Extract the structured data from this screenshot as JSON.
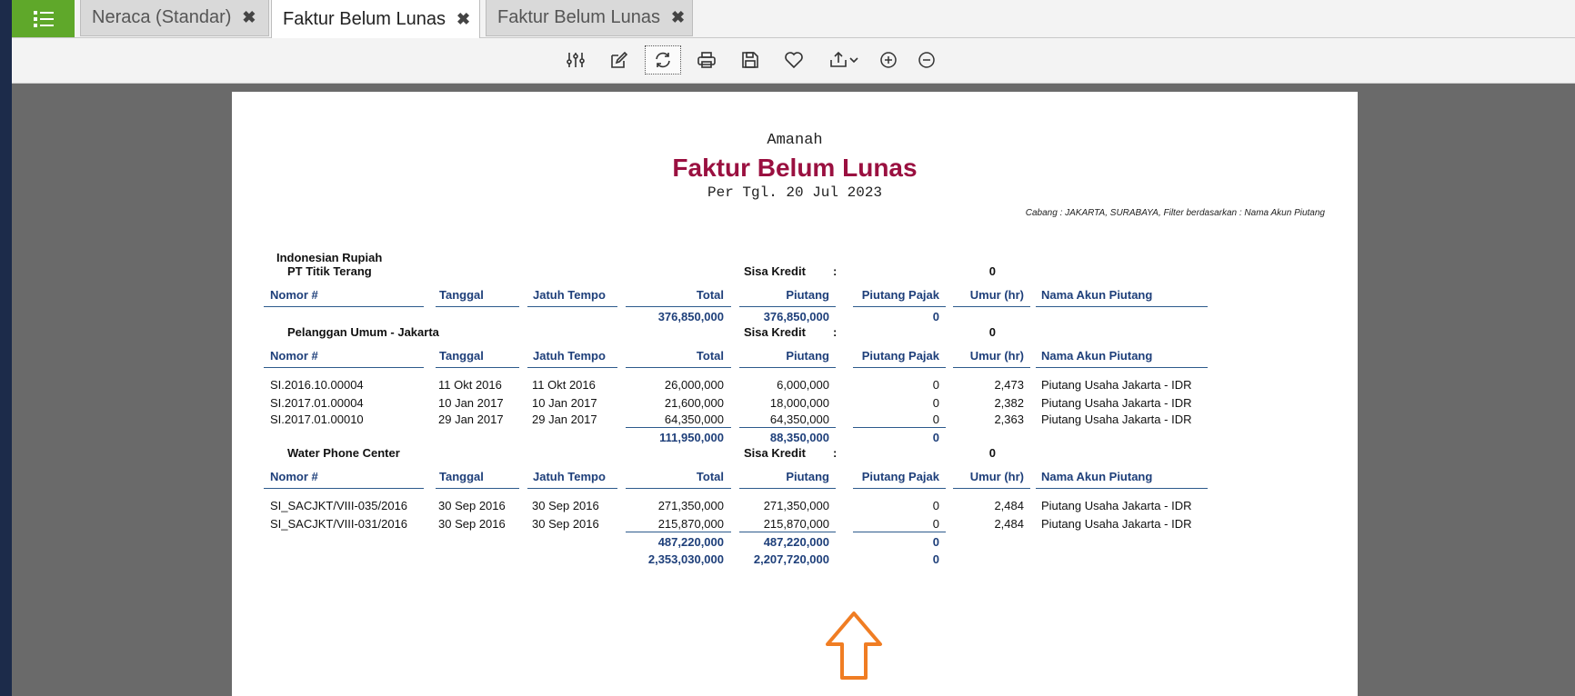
{
  "tabs": [
    {
      "label": "Neraca (Standar)",
      "close": "✖"
    },
    {
      "label": "Faktur Belum Lunas",
      "close": "✖"
    },
    {
      "label": "Faktur Belum Lunas",
      "close": "✖"
    }
  ],
  "toolbar": {
    "icons": [
      "settings-sliders-icon",
      "edit-icon",
      "refresh-icon",
      "print-icon",
      "save-icon",
      "favorite-heart-icon",
      "export-icon",
      "zoom-in-icon",
      "zoom-out-icon"
    ]
  },
  "report": {
    "company": "Amanah",
    "title": "Faktur Belum Lunas",
    "date": "Per Tgl. 20 Jul 2023",
    "filter": "Cabang : JAKARTA, SURABAYA, Filter berdasarkan : Nama Akun Piutang",
    "currency": "Indonesian Rupiah",
    "credit_label": "Sisa Kredit",
    "colon": ":",
    "columns": [
      "Nomor #",
      "Tanggal",
      "Jatuh Tempo",
      "Total",
      "Piutang",
      "Piutang Pajak",
      "Umur (hr)",
      "Nama Akun Piutang"
    ],
    "customers": [
      {
        "name": "PT Titik Terang",
        "credit": "0",
        "rows": [],
        "subtotal": {
          "total": "376,850,000",
          "piutang": "376,850,000",
          "pajak": "0"
        }
      },
      {
        "name": "Pelanggan Umum - Jakarta",
        "credit": "0",
        "rows": [
          {
            "nomor": "SI.2016.10.00004",
            "tanggal": "11 Okt 2016",
            "jatuh_tempo": "11 Okt 2016",
            "total": "26,000,000",
            "piutang": "6,000,000",
            "pajak": "0",
            "umur": "2,473",
            "akun": "Piutang Usaha Jakarta - IDR"
          },
          {
            "nomor": "SI.2017.01.00004",
            "tanggal": "10 Jan 2017",
            "jatuh_tempo": "10 Jan 2017",
            "total": "21,600,000",
            "piutang": "18,000,000",
            "pajak": "0",
            "umur": "2,382",
            "akun": "Piutang Usaha Jakarta - IDR"
          },
          {
            "nomor": "SI.2017.01.00010",
            "tanggal": "29 Jan 2017",
            "jatuh_tempo": "29 Jan 2017",
            "total": "64,350,000",
            "piutang": "64,350,000",
            "pajak": "0",
            "umur": "2,363",
            "akun": "Piutang Usaha Jakarta - IDR"
          }
        ],
        "subtotal": {
          "total": "111,950,000",
          "piutang": "88,350,000",
          "pajak": "0"
        }
      },
      {
        "name": "Water Phone Center",
        "credit": "0",
        "rows": [
          {
            "nomor": "SI_SACJKT/VIII-035/2016",
            "tanggal": "30 Sep 2016",
            "jatuh_tempo": "30 Sep 2016",
            "total": "271,350,000",
            "piutang": "271,350,000",
            "pajak": "0",
            "umur": "2,484",
            "akun": "Piutang Usaha Jakarta - IDR"
          },
          {
            "nomor": "SI_SACJKT/VIII-031/2016",
            "tanggal": "30 Sep 2016",
            "jatuh_tempo": "30 Sep 2016",
            "total": "215,870,000",
            "piutang": "215,870,000",
            "pajak": "0",
            "umur": "2,484",
            "akun": "Piutang Usaha Jakarta - IDR"
          }
        ],
        "subtotal": {
          "total": "487,220,000",
          "piutang": "487,220,000",
          "pajak": "0"
        }
      }
    ],
    "grand_total": {
      "total": "2,353,030,000",
      "piutang": "2,207,720,000",
      "pajak": "0"
    }
  },
  "colors": {
    "accent_green": "#5fa82a",
    "title_red": "#9a1040",
    "header_blue": "#1e3f7a",
    "arrow_orange": "#f07d23"
  }
}
